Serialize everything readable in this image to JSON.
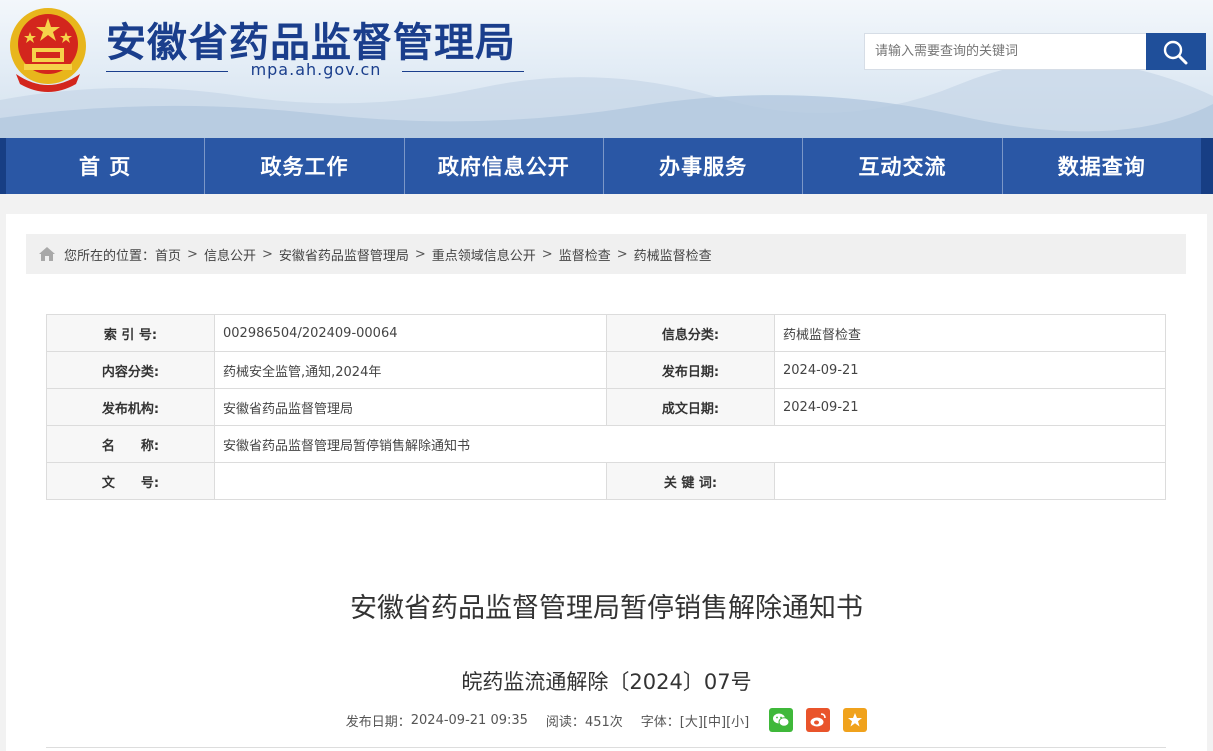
{
  "header": {
    "site_title": "安徽省药品监督管理局",
    "domain": "mpa.ah.gov.cn",
    "search_placeholder": "请输入需要查询的关键词"
  },
  "nav": {
    "items": [
      "首 页",
      "政务工作",
      "政府信息公开",
      "办事服务",
      "互动交流",
      "数据查询"
    ]
  },
  "breadcrumb": {
    "prefix": "您所在的位置：",
    "items": [
      "首页",
      "信息公开",
      "安徽省药品监督管理局",
      "重点领域信息公开",
      "监督检查",
      "药械监督检查"
    ]
  },
  "info_table": {
    "rows": [
      {
        "l1": "索 引 号:",
        "v1": "002986504/202409-00064",
        "l2": "信息分类:",
        "v2": "药械监督检查"
      },
      {
        "l1": "内容分类:",
        "v1": "药械安全监管,通知,2024年",
        "l2": "发布日期:",
        "v2": "2024-09-21"
      },
      {
        "l1": "发布机构:",
        "v1": "安徽省药品监督管理局",
        "l2": "成文日期:",
        "v2": "2024-09-21"
      },
      {
        "l1": "名　　称:",
        "v1": "安徽省药品监督管理局暂停销售解除通知书"
      },
      {
        "l1": "文　　号:",
        "v1": "",
        "l2": "关 键 词:",
        "v2": ""
      }
    ]
  },
  "article": {
    "title": "安徽省药品监督管理局暂停销售解除通知书",
    "number": "皖药监流通解除〔2024〕07号",
    "publish_label": "发布日期：",
    "publish_date": "2024-09-21 09:35",
    "views_label": "阅读：",
    "views": "451次",
    "font_label": "字体：",
    "font_large": "[大]",
    "font_medium": "[中]",
    "font_small": "[小]"
  },
  "colors": {
    "nav_bg": "#2a57a5",
    "title_blue": "#1a3e8c",
    "wechat": "#3fb83a",
    "weibo": "#e9542b",
    "favorite": "#f0a21c"
  }
}
